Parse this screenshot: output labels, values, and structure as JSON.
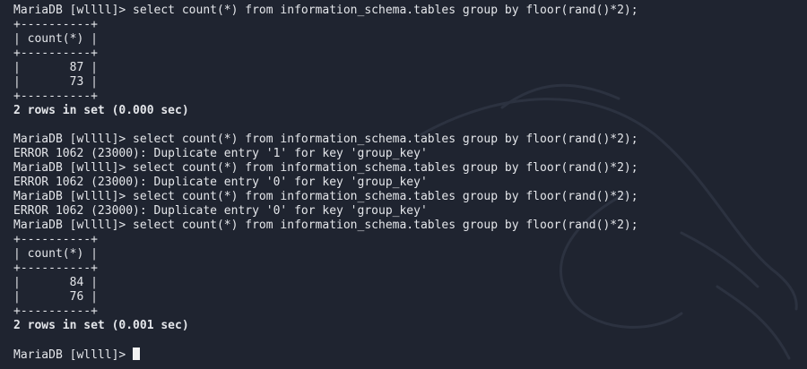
{
  "terminal": {
    "lines": [
      {
        "text": "MariaDB [wllll]> select count(*) from information_schema.tables group by floor(rand()*2);",
        "bold": false
      },
      {
        "text": "+----------+",
        "bold": false
      },
      {
        "text": "| count(*) |",
        "bold": false
      },
      {
        "text": "+----------+",
        "bold": false
      },
      {
        "text": "|       87 |",
        "bold": false
      },
      {
        "text": "|       73 |",
        "bold": false
      },
      {
        "text": "+----------+",
        "bold": false
      },
      {
        "text": "2 rows in set (0.000 sec)",
        "bold": true
      },
      {
        "text": "",
        "bold": false
      },
      {
        "text": "MariaDB [wllll]> select count(*) from information_schema.tables group by floor(rand()*2);",
        "bold": false
      },
      {
        "text": "ERROR 1062 (23000): Duplicate entry '1' for key 'group_key'",
        "bold": false
      },
      {
        "text": "MariaDB [wllll]> select count(*) from information_schema.tables group by floor(rand()*2);",
        "bold": false
      },
      {
        "text": "ERROR 1062 (23000): Duplicate entry '0' for key 'group_key'",
        "bold": false
      },
      {
        "text": "MariaDB [wllll]> select count(*) from information_schema.tables group by floor(rand()*2);",
        "bold": false
      },
      {
        "text": "ERROR 1062 (23000): Duplicate entry '0' for key 'group_key'",
        "bold": false
      },
      {
        "text": "MariaDB [wllll]> select count(*) from information_schema.tables group by floor(rand()*2);",
        "bold": false
      },
      {
        "text": "+----------+",
        "bold": false
      },
      {
        "text": "| count(*) |",
        "bold": false
      },
      {
        "text": "+----------+",
        "bold": false
      },
      {
        "text": "|       84 |",
        "bold": false
      },
      {
        "text": "|       76 |",
        "bold": false
      },
      {
        "text": "+----------+",
        "bold": false
      },
      {
        "text": "2 rows in set (0.001 sec)",
        "bold": true
      },
      {
        "text": "",
        "bold": false
      }
    ],
    "prompt": "MariaDB [wllll]> ",
    "colors": {
      "background": "#1f2430",
      "foreground": "#e4e6ea",
      "cursor": "#f2f2f2"
    }
  }
}
